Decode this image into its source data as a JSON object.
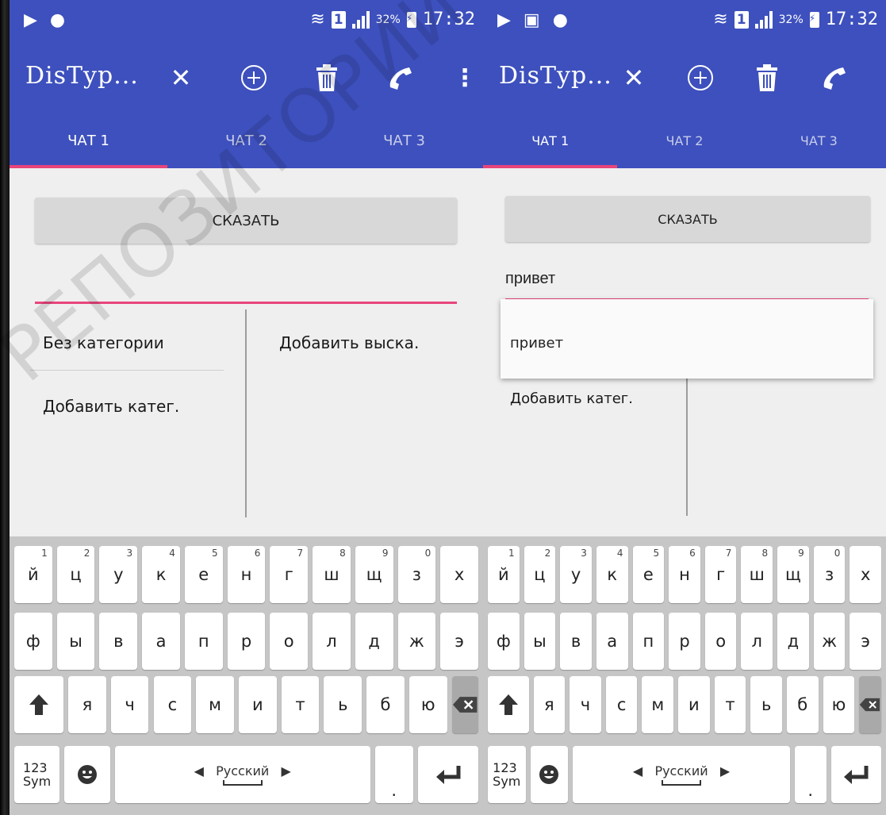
{
  "status_bar": {
    "time": "17:32",
    "battery": "32%"
  },
  "app": {
    "title": "DisTyp..."
  },
  "tabs": [
    "ЧАТ 1",
    "ЧАТ 2",
    "ЧАТ 3"
  ],
  "say_button": "СКАЗАТЬ",
  "left_screen": {
    "input_value": "",
    "categories": [
      "Без категории",
      "Добавить катег."
    ],
    "phrases_add": "Добавить выска."
  },
  "right_screen": {
    "input_value": "привет",
    "suggestion": "привет",
    "categories": [
      "Добавить катег."
    ]
  },
  "keyboard": {
    "row1": [
      "й",
      "ц",
      "у",
      "к",
      "е",
      "н",
      "г",
      "ш",
      "щ",
      "з",
      "х"
    ],
    "row1_nums": [
      "1",
      "2",
      "3",
      "4",
      "5",
      "6",
      "7",
      "8",
      "9",
      "0",
      ""
    ],
    "row2": [
      "ф",
      "ы",
      "в",
      "а",
      "п",
      "р",
      "о",
      "л",
      "д",
      "ж",
      "э"
    ],
    "row3": [
      "я",
      "ч",
      "с",
      "м",
      "и",
      "т",
      "ь",
      "б",
      "ю"
    ],
    "sym_key": "123\nSym",
    "space_label": "Русский",
    "period": "."
  },
  "watermark": "РЕПОЗИТОРИЙ БГПУ",
  "colors": {
    "primary": "#3d50bd",
    "accent": "#e8457b",
    "keyboard_bg": "#c6c6c6"
  }
}
